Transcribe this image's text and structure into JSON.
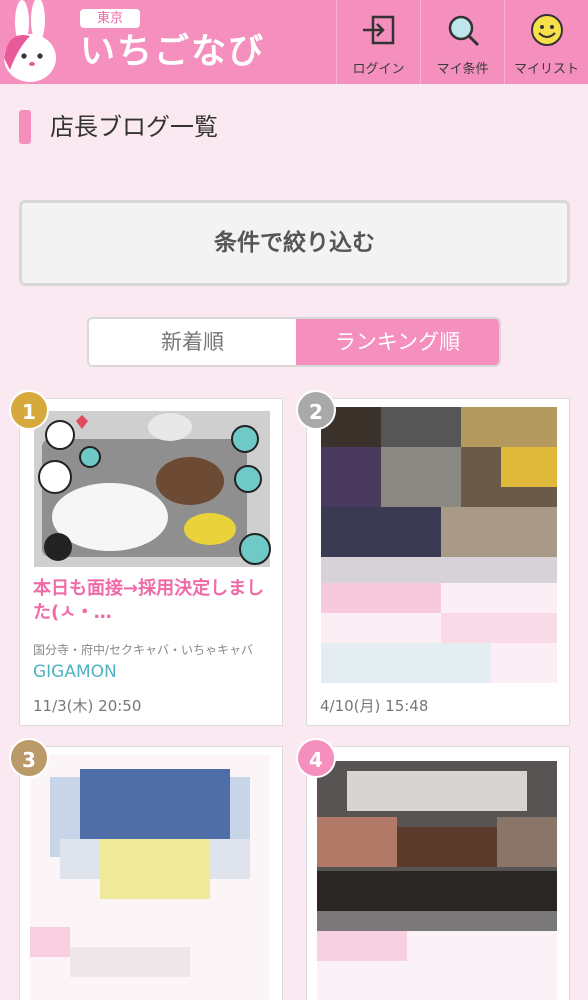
{
  "header": {
    "brand_tag": "東京",
    "brand_logo": "いちごなび",
    "buttons": [
      {
        "label": "ログイン",
        "icon": "login-icon"
      },
      {
        "label": "マイ条件",
        "icon": "search-icon"
      },
      {
        "label": "マイリスト",
        "icon": "smiley-icon"
      }
    ]
  },
  "page": {
    "title": "店長ブログ一覧",
    "filter_label": "条件で絞り込む",
    "sort_tabs": [
      {
        "label": "新着順",
        "active": false
      },
      {
        "label": "ランキング順",
        "active": true
      }
    ]
  },
  "cards": [
    {
      "rank": "1",
      "title": "本日も面接→採用決定しました(ㅅ・…",
      "area": "国分寺・府中/セクキャバ・いちゃキャバ",
      "shop": "GIGAMON",
      "date": "11/3(木) 20:50"
    },
    {
      "rank": "2",
      "title": "",
      "area": "",
      "shop": "",
      "date": "4/10(月) 15:48"
    },
    {
      "rank": "3",
      "title": "",
      "area": "",
      "shop": "",
      "date": ""
    },
    {
      "rank": "4",
      "title": "",
      "area": "",
      "shop": "",
      "date": ""
    }
  ],
  "colors": {
    "accent": "#f48fbe",
    "title_pink": "#f06aa6",
    "shop_teal": "#4fb3c2",
    "gold": "#d6a93c",
    "silver": "#a9a9a9",
    "bronze": "#b99a68"
  }
}
